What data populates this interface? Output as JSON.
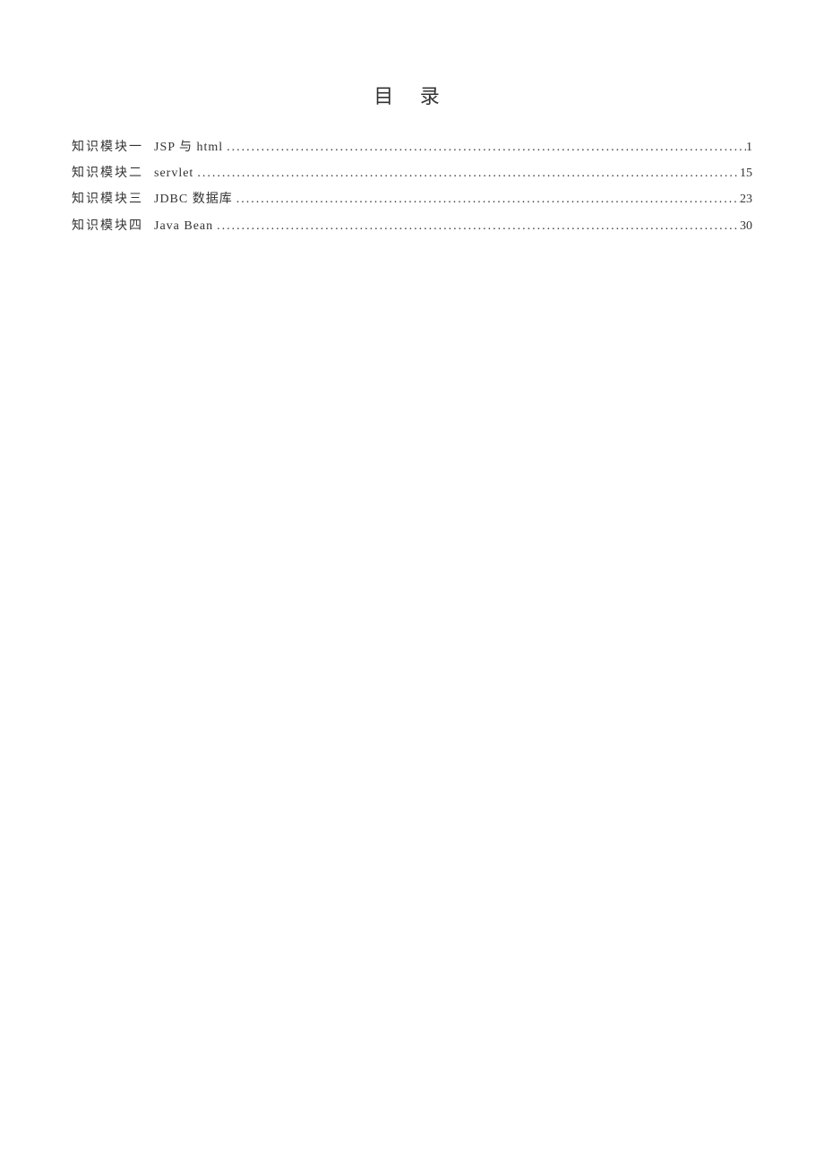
{
  "title": "目 录",
  "toc": [
    {
      "module": "知识模块一",
      "topic": "JSP 与 html",
      "page": "1"
    },
    {
      "module": "知识模块二",
      "topic": "servlet",
      "page": "15"
    },
    {
      "module": "知识模块三",
      "topic": "JDBC 数据库",
      "page": "23"
    },
    {
      "module": "知识模块四",
      "topic": "Java Bean",
      "page": "30"
    }
  ]
}
